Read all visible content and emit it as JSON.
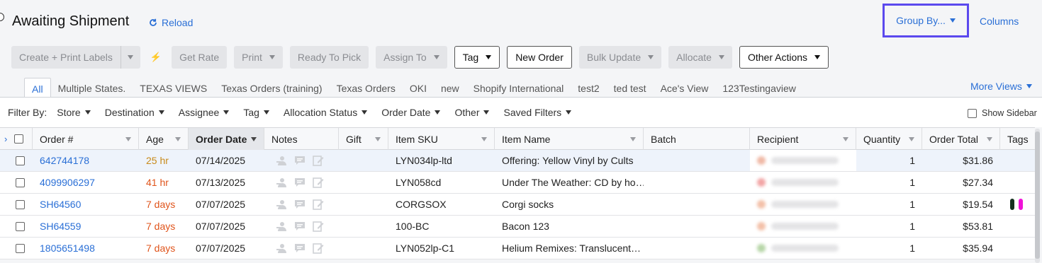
{
  "header": {
    "title": "Awaiting Shipment",
    "reload_label": "Reload",
    "group_by_label": "Group By...",
    "columns_label": "Columns"
  },
  "toolbar": {
    "create_print": "Create + Print Labels",
    "get_rate": "Get Rate",
    "print": "Print",
    "ready_to_pick": "Ready To Pick",
    "assign_to": "Assign To",
    "tag": "Tag",
    "new_order": "New Order",
    "bulk_update": "Bulk Update",
    "allocate": "Allocate",
    "other_actions": "Other Actions"
  },
  "views": {
    "tabs": [
      "All",
      "Multiple States.",
      "TEXAS VIEWS",
      "Texas Orders (training)",
      "Texas Orders",
      "OKI",
      "new",
      "Shopify International",
      "test2",
      "ted test",
      "Ace's View",
      "123Testingaview"
    ],
    "active": "All",
    "more_views": "More Views"
  },
  "filters": {
    "label": "Filter By:",
    "items": [
      "Store",
      "Destination",
      "Assignee",
      "Tag",
      "Allocation Status",
      "Order Date",
      "Other",
      "Saved Filters"
    ],
    "show_sidebar": "Show Sidebar"
  },
  "grid": {
    "columns": [
      "Order #",
      "Age",
      "Order Date",
      "Notes",
      "Gift",
      "Item SKU",
      "Item Name",
      "Batch",
      "Recipient",
      "Quantity",
      "Order Total",
      "Tags"
    ],
    "sorted_column": "Order Date",
    "rows": [
      {
        "order": "642744178",
        "age": "25 hr",
        "age_level": "orange",
        "date": "07/14/2025",
        "sku": "LYN034lp-ltd",
        "item": "Offering: Yellow Vinyl by Cults",
        "qty": "1",
        "total": "$31.86",
        "tags": [],
        "dot": "#f0b9a6"
      },
      {
        "order": "4099906297",
        "age": "41 hr",
        "age_level": "red",
        "date": "07/13/2025",
        "sku": "LYN058cd",
        "item": "Under The Weather: CD by ho…",
        "qty": "1",
        "total": "$27.34",
        "tags": [],
        "dot": "#f2a5a5"
      },
      {
        "order": "SH64560",
        "age": "7 days",
        "age_level": "red",
        "date": "07/07/2025",
        "sku": "CORGSOX",
        "item": "Corgi socks",
        "qty": "1",
        "total": "$19.54",
        "tags": [
          "#15301f",
          "#f012d8"
        ],
        "dot": "#f3c0a8"
      },
      {
        "order": "SH64559",
        "age": "7 days",
        "age_level": "red",
        "date": "07/07/2025",
        "sku": "100-BC",
        "item": "Bacon 123",
        "qty": "1",
        "total": "$53.81",
        "tags": [],
        "dot": "#f3c0a8"
      },
      {
        "order": "1805651498",
        "age": "7 days",
        "age_level": "red",
        "date": "07/07/2025",
        "sku": "LYN052lp-C1",
        "item": "Helium Remixes: Translucent…",
        "qty": "1",
        "total": "$35.94",
        "tags": [],
        "dot": "#b7d6a8"
      }
    ]
  },
  "colors": {
    "accent": "#2a6fd6",
    "group_by_border": "#5b49ee",
    "age_orange": "#c88a1a",
    "age_red": "#e0541b"
  }
}
